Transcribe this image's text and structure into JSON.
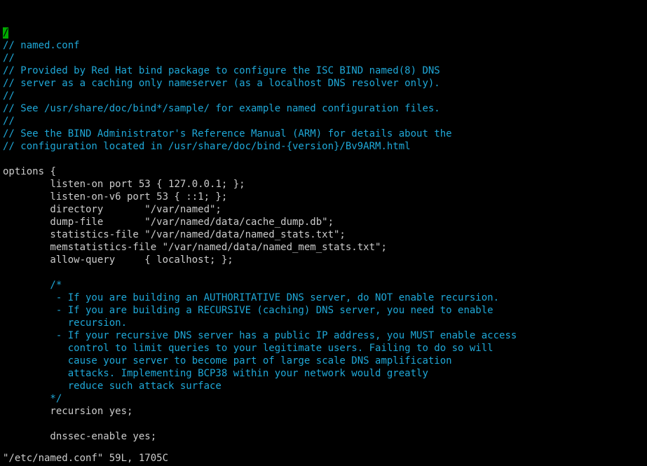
{
  "cursor_char": "/",
  "lines": [
    {
      "cls": "comment",
      "text": "/"
    },
    {
      "cls": "comment",
      "text": "// named.conf"
    },
    {
      "cls": "comment",
      "text": "//"
    },
    {
      "cls": "comment",
      "text": "// Provided by Red Hat bind package to configure the ISC BIND named(8) DNS"
    },
    {
      "cls": "comment",
      "text": "// server as a caching only nameserver (as a localhost DNS resolver only)."
    },
    {
      "cls": "comment",
      "text": "//"
    },
    {
      "cls": "comment",
      "text": "// See /usr/share/doc/bind*/sample/ for example named configuration files."
    },
    {
      "cls": "comment",
      "text": "//"
    },
    {
      "cls": "comment",
      "text": "// See the BIND Administrator's Reference Manual (ARM) for details about the"
    },
    {
      "cls": "comment",
      "text": "// configuration located in /usr/share/doc/bind-{version}/Bv9ARM.html"
    },
    {
      "cls": "plain",
      "text": ""
    },
    {
      "cls": "kw-line",
      "kw": "options",
      "rest": " {"
    },
    {
      "cls": "listen",
      "indent": "        ",
      "kw": "listen-on",
      "rest": " port 53 { 127.0.0.1; };"
    },
    {
      "cls": "plain",
      "text": "        listen-on-v6 port 53 { ::1; };"
    },
    {
      "cls": "plain",
      "text": "        directory       \"/var/named\";"
    },
    {
      "cls": "plain",
      "text": "        dump-file       \"/var/named/data/cache_dump.db\";"
    },
    {
      "cls": "plain",
      "text": "        statistics-file \"/var/named/data/named_stats.txt\";"
    },
    {
      "cls": "plain",
      "text": "        memstatistics-file \"/var/named/data/named_mem_stats.txt\";"
    },
    {
      "cls": "plain",
      "text": "        allow-query     { localhost; };"
    },
    {
      "cls": "plain",
      "text": ""
    },
    {
      "cls": "comment",
      "text": "        /*"
    },
    {
      "cls": "comment",
      "text": "         - If you are building an AUTHORITATIVE DNS server, do NOT enable recursion."
    },
    {
      "cls": "comment",
      "text": "         - If you are building a RECURSIVE (caching) DNS server, you need to enable"
    },
    {
      "cls": "comment",
      "text": "           recursion."
    },
    {
      "cls": "comment",
      "text": "         - If your recursive DNS server has a public IP address, you MUST enable access"
    },
    {
      "cls": "comment",
      "text": "           control to limit queries to your legitimate users. Failing to do so will"
    },
    {
      "cls": "comment",
      "text": "           cause your server to become part of large scale DNS amplification"
    },
    {
      "cls": "comment",
      "text": "           attacks. Implementing BCP38 within your network would greatly"
    },
    {
      "cls": "comment",
      "text": "           reduce such attack surface"
    },
    {
      "cls": "comment",
      "text": "        */"
    },
    {
      "cls": "plain",
      "text": "        recursion yes;"
    },
    {
      "cls": "plain",
      "text": ""
    },
    {
      "cls": "plain",
      "text": "        dnssec-enable yes;"
    }
  ],
  "status": "\"/etc/named.conf\" 59L, 1705C"
}
